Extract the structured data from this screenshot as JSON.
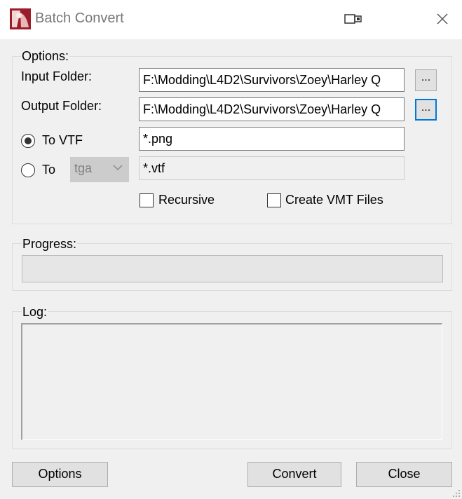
{
  "window": {
    "title": "Batch Convert"
  },
  "options_group": {
    "label": "Options:",
    "input_folder_label": "Input Folder:",
    "input_folder_value": "F:\\Modding\\L4D2\\Survivors\\Zoey\\Harley Q",
    "output_folder_label": "Output Folder:",
    "output_folder_value": "F:\\Modding\\L4D2\\Survivors\\Zoey\\Harley Q",
    "browse_label": "...",
    "to_vtf_label": "To VTF",
    "to_label": "To",
    "format_selected": "tga",
    "input_filter": "*.png",
    "output_filter": "*.vtf",
    "recursive_label": "Recursive",
    "create_vmt_label": "Create VMT Files",
    "to_vtf_checked": true,
    "recursive_checked": false,
    "create_vmt_checked": false
  },
  "progress_group": {
    "label": "Progress:",
    "progress": 0
  },
  "log_group": {
    "label": "Log:"
  },
  "buttons": {
    "options": "Options",
    "convert": "Convert",
    "close": "Close"
  },
  "icons": {
    "app": "app-icon",
    "pin": "pin-icon",
    "close": "close-icon",
    "dropdown": "chevron-down-icon",
    "grip": "resize-grip-icon"
  },
  "colors": {
    "accent": "#0078d7",
    "window_bg": "#f0f0f0",
    "titlebar_bg": "#ffffff"
  }
}
